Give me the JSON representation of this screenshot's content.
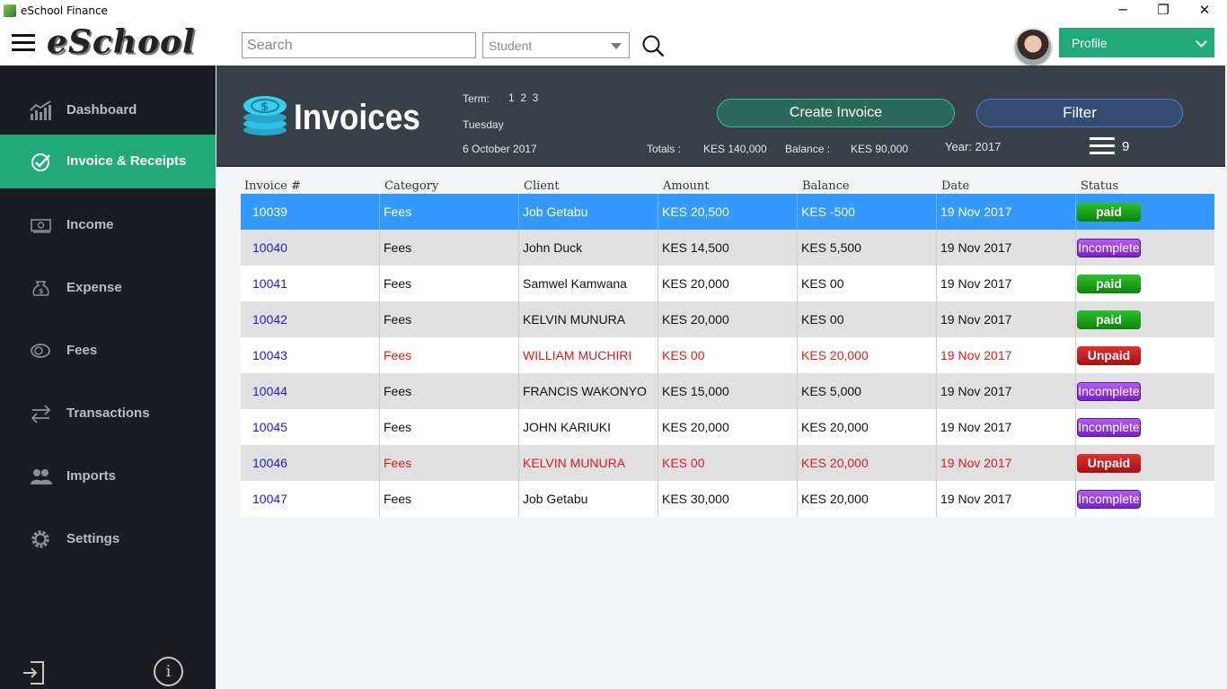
{
  "window": {
    "title": "eSchool Finance",
    "minimize": "─",
    "maximize": "❐",
    "close": "✕"
  },
  "topbar": {
    "logo": "eSchool",
    "search_placeholder": "Search",
    "filter_select": "Student",
    "profile_label": "Profile"
  },
  "sidebar": {
    "items": [
      {
        "label": "Dashboard",
        "icon": "chart-icon"
      },
      {
        "label": "Invoice & Receipts",
        "icon": "check-circle-icon"
      },
      {
        "label": "Income",
        "icon": "money-icon"
      },
      {
        "label": "Expense",
        "icon": "money-bag-icon"
      },
      {
        "label": "Fees",
        "icon": "coin-icon"
      },
      {
        "label": "Transactions",
        "icon": "transfer-arrows-icon"
      },
      {
        "label": "Imports",
        "icon": "users-icon"
      },
      {
        "label": "Settings",
        "icon": "gear-icon"
      }
    ],
    "info": "i"
  },
  "header": {
    "title": "Invoices",
    "term_label": "Term:",
    "terms": "1  2  3",
    "day": "Tuesday",
    "date": "6 October 2017",
    "totals_label": "Totals :",
    "totals_value": "KES 140,000",
    "balance_label": "Balance :",
    "balance_value": "KES 90,000",
    "year": "Year: 2017",
    "create_label": "Create Invoice",
    "filter_label": "Filter",
    "count": "9"
  },
  "table": {
    "columns": [
      "Invoice #",
      "Category",
      "Client",
      "Amount",
      "Balance",
      "Date",
      "Status"
    ],
    "rows": [
      {
        "invoice": "10039",
        "category": "Fees",
        "client": "Job  Getabu",
        "amount": "KES 20,500",
        "balance": "KES -500",
        "date": "19 Nov 2017",
        "status": "paid"
      },
      {
        "invoice": "10040",
        "category": "Fees",
        "client": "John Duck",
        "amount": "KES 14,500",
        "balance": "KES 5,500",
        "date": "19 Nov 2017",
        "status": "Incomplete"
      },
      {
        "invoice": "10041",
        "category": "Fees",
        "client": "Samwel  Kamwana",
        "amount": "KES 20,000",
        "balance": "KES 00",
        "date": "19 Nov 2017",
        "status": "paid"
      },
      {
        "invoice": "10042",
        "category": "Fees",
        "client": "KELVIN MUNURA",
        "amount": "KES 20,000",
        "balance": "KES 00",
        "date": "19 Nov 2017",
        "status": "paid"
      },
      {
        "invoice": "10043",
        "category": "Fees",
        "client": "WILLIAM MUCHIRI",
        "amount": "KES 00",
        "balance": "KES 20,000",
        "date": "19 Nov 2017",
        "status": "Unpaid"
      },
      {
        "invoice": "10044",
        "category": "Fees",
        "client": "FRANCIS WAKONYO",
        "amount": "KES 15,000",
        "balance": "KES 5,000",
        "date": "19 Nov 2017",
        "status": "Incomplete"
      },
      {
        "invoice": "10045",
        "category": "Fees",
        "client": "JOHN KARIUKI",
        "amount": "KES 20,000",
        "balance": "KES 20,000",
        "date": "19 Nov 2017",
        "status": "Incomplete"
      },
      {
        "invoice": "10046",
        "category": "Fees",
        "client": "KELVIN MUNURA",
        "amount": "KES 00",
        "balance": "KES 20,000",
        "date": "19 Nov 2017",
        "status": "Unpaid"
      },
      {
        "invoice": "10047",
        "category": "Fees",
        "client": "Job  Getabu",
        "amount": "KES 30,000",
        "balance": "KES 20,000",
        "date": "19 Nov 2017",
        "status": "Incomplete"
      }
    ]
  },
  "colors": {
    "accent": "#21a97a",
    "sidebar": "#1b1c22",
    "header": "#3a4047",
    "selected_row": "#3399ff",
    "unpaid_text": "#e01b1b"
  }
}
